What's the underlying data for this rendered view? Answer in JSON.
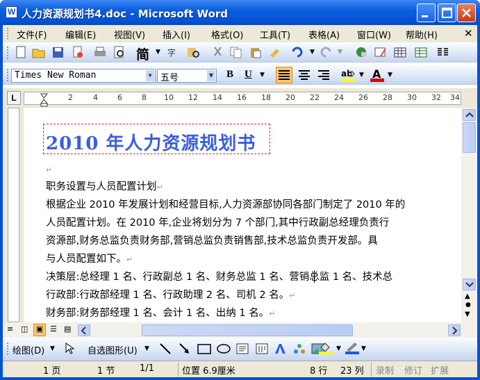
{
  "window": {
    "title": "人力资源规划书4.doc - Microsoft Word"
  },
  "menu": [
    "文件(F)",
    "编辑(E)",
    "视图(V)",
    "插入(I)",
    "格式(O)",
    "工具(T)",
    "表格(A)",
    "窗口(W)",
    "帮助(H)"
  ],
  "toolbar": {
    "chinese_convert": "简"
  },
  "format": {
    "font_name": "Times New Roman",
    "font_size": "五号"
  },
  "ruler": {
    "ticks": [
      "2",
      "4",
      "6",
      "8",
      "10",
      "12",
      "14",
      "16",
      "18",
      "20",
      "22",
      "24",
      "26",
      "28",
      "30",
      "32",
      "34"
    ]
  },
  "doc": {
    "title": "2010 年人力资源规划书",
    "lines": [
      "职务设置与人员配置计划",
      "根据企业 2010 年发展计划和经营目标,人力资源部协同各部门制定了 2010 年的",
      "人员配置计划。在 2010 年,企业将划分为 7 个部门,其中行政副总经理负责行",
      "资源部,财务总监负责财务部,营销总监负责销售部,技术总监负责开发部。具",
      "与人员配置如下。",
      "决策层:总经理 1 名、行政副总 1 名、财务总监 1 名、营销总监 1 名、技术总",
      "行政部:行政部经理 1 名、行政助理 2 名、司机 2 名。",
      "财务部:财务部经理 1 名、会计 1 名、出纳 1 名。"
    ]
  },
  "drawing": {
    "draw_label": "绘图(D)",
    "autoshape_label": "自选图形(U)"
  },
  "status": {
    "page": "1 页",
    "section": "1 节",
    "page_of": "1/1",
    "position": "位置 6.9厘米",
    "line": "8 行",
    "col": "23 列",
    "rec": "录制",
    "trk": "修订",
    "ext": "扩展"
  }
}
